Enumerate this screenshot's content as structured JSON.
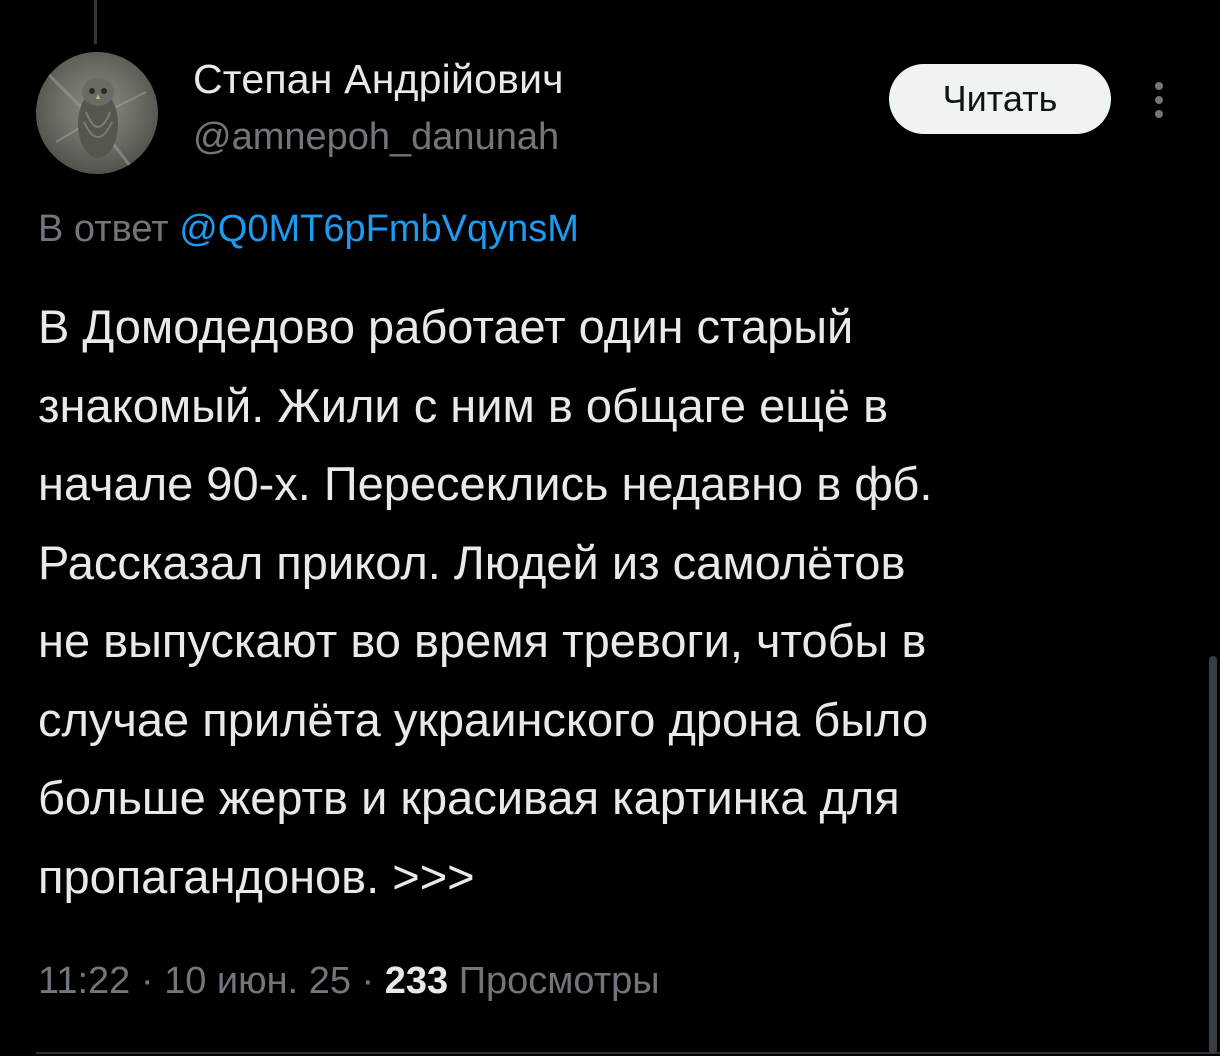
{
  "author": {
    "display_name": "Степан Андрійович",
    "handle": "@amnepoh_danunah"
  },
  "follow_button": {
    "label": "Читать"
  },
  "more_menu": {
    "icon": "vertical-ellipsis-icon"
  },
  "reply_context": {
    "prefix": "В ответ ",
    "mention": "@Q0MT6pFmbVqynsM"
  },
  "tweet": {
    "lines": [
      "В Домодедово работает один старый",
      "знакомый. Жили с ним в общаге ещё в",
      "начале 90-х. Пересеклись недавно в фб.",
      "Рассказал прикол. Людей из самолётов",
      "не выпускают во время тревоги, чтобы в",
      "случае прилёта украинского дрона было",
      "больше жертв и красивая картинка для",
      "пропагандонов. >>>"
    ]
  },
  "meta": {
    "time": "11:22",
    "separator": " · ",
    "date": "10 июн. 25",
    "views_count": "233",
    "views_label": " Просмотры"
  },
  "colors": {
    "background": "#000000",
    "text_primary": "#e7e9ea",
    "text_secondary": "#71767b",
    "link": "#1d9bf0",
    "button_bg": "#eff3f4"
  }
}
